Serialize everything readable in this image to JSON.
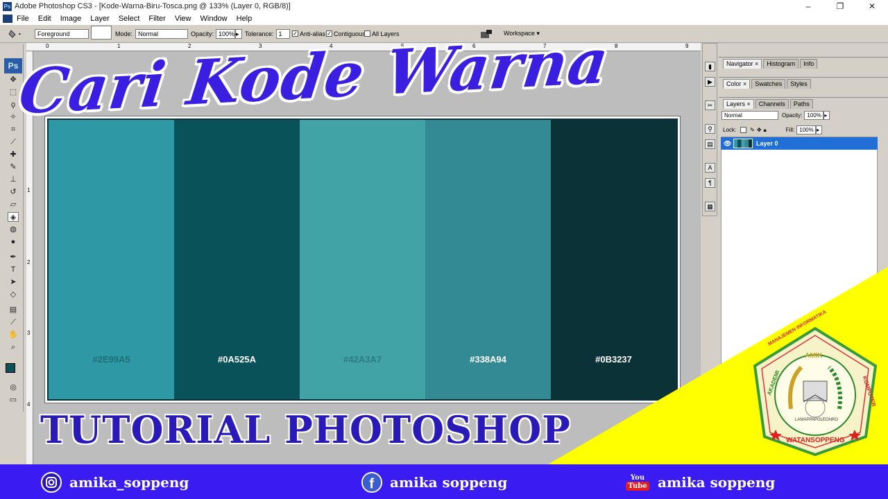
{
  "window": {
    "title": "Adobe Photoshop CS3 - [Kode-Warna-Biru-Tosca.png @ 133% (Layer 0, RGB/8)]",
    "controls": [
      "–",
      "❐",
      "✕"
    ]
  },
  "menu": [
    "File",
    "Edit",
    "Image",
    "Layer",
    "Select",
    "Filter",
    "View",
    "Window",
    "Help"
  ],
  "options": {
    "fill_source": "Foreground",
    "mode_label": "Mode:",
    "mode_value": "Normal",
    "opacity_label": "Opacity:",
    "opacity_value": "100%",
    "tolerance_label": "Tolerance:",
    "tolerance_value": "1",
    "antialias_label": "Anti-alias",
    "contiguous_label": "Contiguous",
    "all_layers_label": "All Layers",
    "workspace_label": "Workspace ▾"
  },
  "ruler_top_ticks": [
    "0",
    "1",
    "2",
    "3",
    "4",
    "5",
    "6",
    "7",
    "8",
    "9"
  ],
  "ruler_left_ticks": [
    "1",
    "2",
    "3",
    "4"
  ],
  "swatches": [
    {
      "hex": "#2E99A5",
      "label": "#2E99A5",
      "text_color": "#1f6e76"
    },
    {
      "hex": "#0A525A",
      "label": "#0A525A",
      "text_color": "#ffffff"
    },
    {
      "hex": "#42A3A7",
      "label": "#42A3A7",
      "text_color": "#2b7a7e"
    },
    {
      "hex": "#338A94",
      "label": "#338A94",
      "text_color": "#ffffff"
    },
    {
      "hex": "#0B3237",
      "label": "#0B3237",
      "text_color": "#ffffff"
    }
  ],
  "panels": {
    "group1": [
      "Navigator ×",
      "Histogram",
      "Info"
    ],
    "group2": [
      "Color ×",
      "Swatches",
      "Styles"
    ],
    "group3": [
      "Layers ×",
      "Channels",
      "Paths"
    ],
    "blend_mode": "Normal",
    "opacity_label": "Opacity:",
    "opacity_value": "100%",
    "lock_label": "Lock:",
    "fill_label": "Fill:",
    "fill_value": "100%",
    "layer_name": "Layer 0"
  },
  "overlay": {
    "hero_title": "Cari Kode Warna",
    "subtitle": "TUTORIAL PHOTOSHOP"
  },
  "logo": {
    "top_arc": "AMIK",
    "ring_left": "AKADEMI",
    "ring_top": "MANAJEMEN INFORMATIKA",
    "ring_right": "KOMPUTER",
    "bottom": "WATANSOPPENG",
    "inner": "LAMAPPAPOLEONRO"
  },
  "footer": {
    "instagram": "amika_soppeng",
    "facebook": "amika soppeng",
    "youtube": "amika soppeng",
    "youtube_badge_top": "You",
    "youtube_badge_bottom": "Tube"
  },
  "colors": {
    "footer_bg": "#3a1bf2",
    "title_purple": "#3b1fe0",
    "yellow": "#ffff00"
  }
}
